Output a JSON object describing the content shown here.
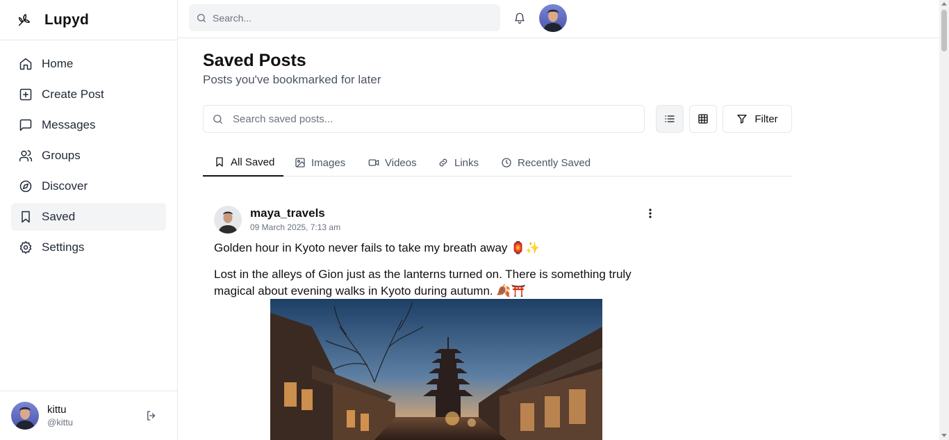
{
  "brand": {
    "name": "Lupyd",
    "logo_icon": "feather-logo-icon"
  },
  "sidebar": {
    "items": [
      {
        "label": "Home",
        "icon": "home-icon"
      },
      {
        "label": "Create Post",
        "icon": "plus-square-icon"
      },
      {
        "label": "Messages",
        "icon": "message-icon"
      },
      {
        "label": "Groups",
        "icon": "users-icon"
      },
      {
        "label": "Discover",
        "icon": "compass-icon"
      },
      {
        "label": "Saved",
        "icon": "bookmark-icon",
        "active": true
      },
      {
        "label": "Settings",
        "icon": "gear-icon"
      }
    ],
    "user": {
      "name": "kittu",
      "handle": "@kittu"
    }
  },
  "topbar": {
    "search_placeholder": "Search..."
  },
  "page": {
    "title": "Saved Posts",
    "subtitle": "Posts you've bookmarked for later",
    "search_placeholder": "Search saved posts...",
    "filter_label": "Filter",
    "view_mode": "list"
  },
  "tabs": [
    {
      "label": "All Saved",
      "icon": "bookmark-icon",
      "active": true
    },
    {
      "label": "Images",
      "icon": "image-icon"
    },
    {
      "label": "Videos",
      "icon": "video-icon"
    },
    {
      "label": "Links",
      "icon": "link-icon"
    },
    {
      "label": "Recently Saved",
      "icon": "clock-icon"
    }
  ],
  "post": {
    "username": "maya_travels",
    "timestamp": "09 March 2025, 7:13 am",
    "title": "Golden hour in Kyoto never fails to take my breath away 🏮✨",
    "body": "Lost in the alleys of Gion just as the lanterns turned on. There is something truly magical about evening walks in Kyoto during autumn. 🍂⛩️"
  },
  "colors": {
    "active_bg": "#f3f4f6",
    "border": "#e5e7eb",
    "muted_text": "#6b7280"
  }
}
